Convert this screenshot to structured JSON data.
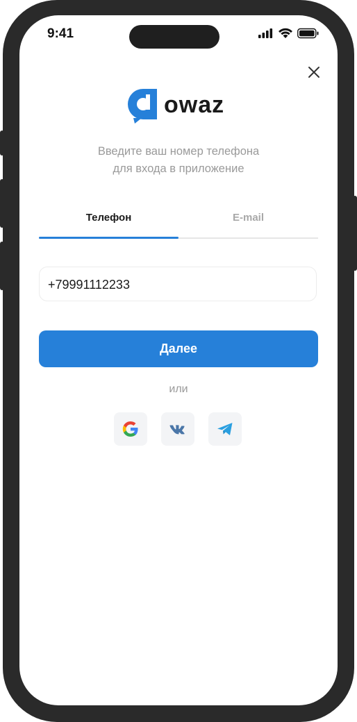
{
  "status_bar": {
    "time": "9:41"
  },
  "logo": {
    "text": "owaz"
  },
  "subtitle": {
    "line1": "Введите ваш номер телефона",
    "line2": "для входа в приложение"
  },
  "tabs": [
    {
      "label": "Телефон",
      "active": true
    },
    {
      "label": "E-mail",
      "active": false
    }
  ],
  "phone_input": {
    "value": "+79991112233"
  },
  "next_button": {
    "label": "Далее"
  },
  "divider_text": "или",
  "social": [
    {
      "icon": "google-icon"
    },
    {
      "icon": "vk-icon"
    },
    {
      "icon": "telegram-icon"
    }
  ],
  "colors": {
    "accent": "#2680d9",
    "frame": "#2a2a2a"
  }
}
